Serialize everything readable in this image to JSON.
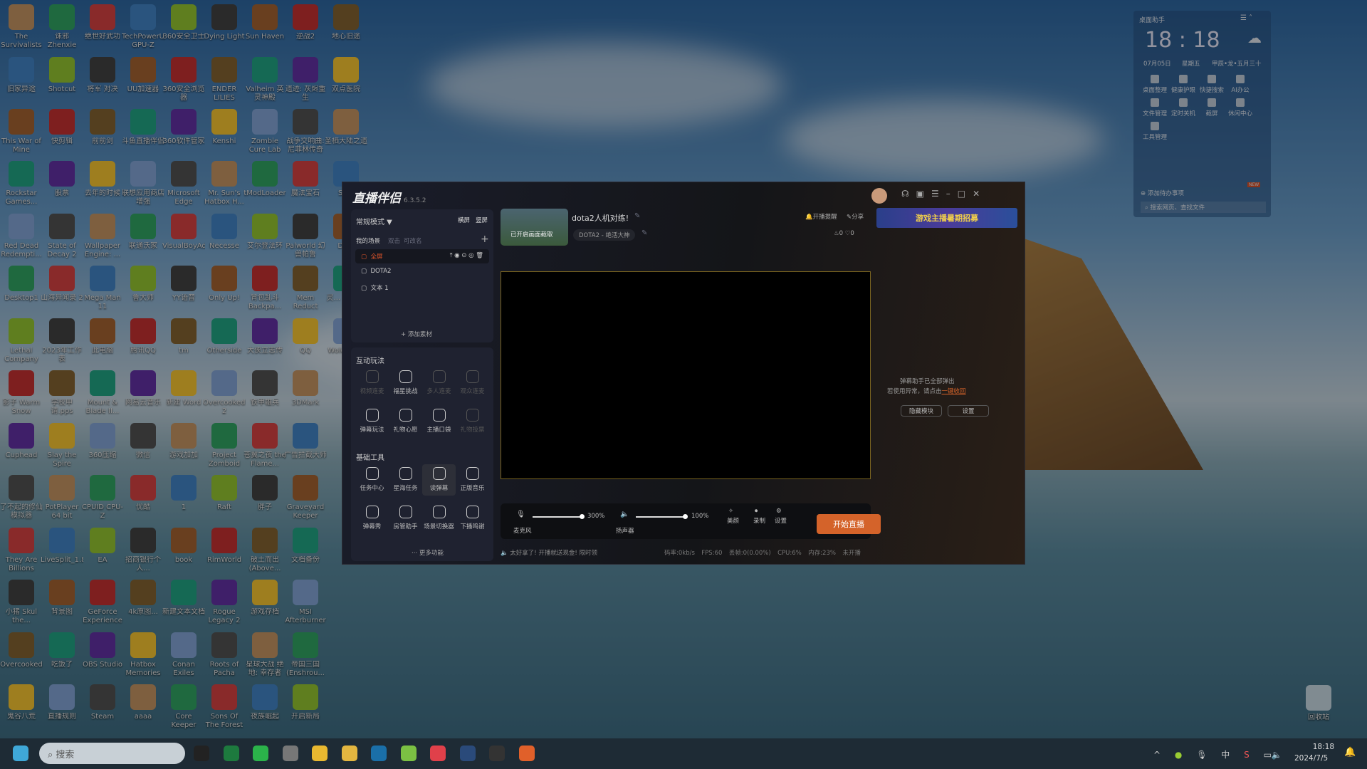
{
  "desktop": {
    "rows": [
      [
        "The Survivalists",
        "诛邪 Zhenxie",
        "绝世好武功",
        "TechPowerUp GPU-Z",
        "360安全卫士",
        "Dying Light",
        "Sun Haven",
        "逆战2",
        "地心旧途"
      ],
      [
        "旧家异途",
        "Shotcut",
        "将军 对决",
        "UU加速器",
        "360安全浏览器",
        "ENDER LILIES",
        "Valheim 英灵神殿",
        "遗迹: 灰烬重生",
        "双点医院"
      ],
      [
        "This War of Mine",
        "快剪辑",
        "前前剑",
        "斗鱼直播伴侣",
        "360软件管家",
        "Kenshi",
        "Zombie Cure Lab",
        "战争交响曲: 尼菲林传奇",
        "圣栖大陆之遗"
      ],
      [
        "Rockstar Games...",
        "股票",
        "去年的时候",
        "联想应用商店增强",
        "Microsoft Edge",
        "Mr. Sun's Hatbox H...",
        "tModLoader",
        "魔法宝石",
        "Sa..."
      ],
      [
        "Red Dead Redempti...",
        "State of Decay 2",
        "Wallpaper Engine: ...",
        "联通沃家",
        "VisualBoyAdvance[1.8...",
        "Necesse",
        "艾尔登法环",
        "Palworld 幻兽帕鲁",
        "Do..."
      ],
      [
        "Desktop1",
        "山海异闻录 2",
        "Mega Man 11",
        "鲁大师",
        "YY语音",
        "Only Up!",
        "背包乱斗 Backpa...",
        "Mem Reduct",
        "灵... (Sou..."
      ],
      [
        "Lethal Company",
        "2023年工作表",
        "此电脑",
        "腾讯QQ",
        "tm",
        "Otherside",
        "大侠立志传",
        "QQ",
        "Wolo Far..."
      ],
      [
        "影子 Warm Snow",
        "学校申请.pps",
        "Mount & Blade II...",
        "网易云音乐",
        "新建 Word",
        "Overcooked! 2",
        "铁甲雄兵",
        "3DMark"
      ],
      [
        "Cuphead",
        "Slay the Spire",
        "360压缩",
        "微信",
        "游戏加加",
        "Project Zomboid",
        "苍翼之夜 the Flame...",
        "广告拦截大师"
      ],
      [
        "了不起的修仙模拟器",
        "PotPlayer 64 bit",
        "CPUID CPU-Z",
        "优酷",
        "1",
        "Raft",
        "胖子",
        "Graveyard Keeper"
      ],
      [
        "They Are Billions",
        "LiveSplit_1.8.29",
        "EA",
        "招商银行个人...",
        "book",
        "RimWorld",
        "破土而出 (Above...",
        "文档备份"
      ],
      [
        "小猪 Skul the...",
        "背景图",
        "GeForce Experience",
        "4k原图...",
        "新建文本文档",
        "Rogue Legacy 2",
        "游戏存档",
        "MSI Afterburner"
      ],
      [
        "Overcooked",
        "吃饭了",
        "OBS Studio",
        "Hatbox Memories",
        "Conan Exiles",
        "Roots of Pacha",
        "星球大战 绝地: 幸存者",
        "帝国三国 (Enshrou..."
      ],
      [
        "鬼谷八荒",
        "直播规则",
        "Steam",
        "aaaa",
        "Core Keeper",
        "Sons Of The Forest",
        "夜族崛起",
        "开启新局"
      ]
    ],
    "recycle_bin": "回收站"
  },
  "app": {
    "name": "直播伴侣",
    "version": "6.3.5.2",
    "mode": "常规模式",
    "orient_h": "横屏",
    "orient_v": "竖屏",
    "scenes_label": "我的场景",
    "scenes_hint1": "双击",
    "scenes_hint2": "可改名",
    "scenes": [
      {
        "label": "全屏",
        "active": true
      },
      {
        "label": "DOTA2"
      },
      {
        "label": "文本 1"
      }
    ],
    "add_material": "添加素材",
    "interactive_title": "互动玩法",
    "interactive": [
      {
        "label": "视频连麦",
        "off": true
      },
      {
        "label": "福星挑战"
      },
      {
        "label": "多人连麦",
        "off": true
      },
      {
        "label": "观众连麦",
        "off": true
      },
      {
        "label": "弹幕玩法"
      },
      {
        "label": "礼物心愿"
      },
      {
        "label": "主播口袋"
      },
      {
        "label": "礼物投票",
        "off": true
      }
    ],
    "tools_title": "基础工具",
    "tools": [
      {
        "label": "任务中心"
      },
      {
        "label": "星海任务"
      },
      {
        "label": "读弹幕",
        "selected": true
      },
      {
        "label": "正版音乐"
      },
      {
        "label": "弹幕秀"
      },
      {
        "label": "房管助手"
      },
      {
        "label": "场景切换器"
      },
      {
        "label": "下播鸣谢"
      }
    ],
    "more": "更多功能",
    "stream_title": "dota2人机对练!",
    "thumb_caption": "已开启画面截取",
    "category": "DOTA2 - 绝活大神",
    "remind": "开播提醒",
    "share": "分享",
    "fire_count": "0",
    "like_count": "0",
    "banner": "游戏主播暑期招募",
    "mic_label": "麦克风",
    "mic_volume": "300%",
    "speaker_label": "扬声器",
    "speaker_volume": "100%",
    "beauty": "美颜",
    "record": "录制",
    "settings": "设置",
    "start": "开始直播",
    "notice": "太好拿了! 开播就送现金! 限时领",
    "stats": {
      "bitrate": "码率:0kb/s",
      "fps": "FPS:60",
      "dropped": "丢帧:0(0.00%)",
      "cpu": "CPU:6%",
      "mem": "内存:23%",
      "state": "未开播"
    },
    "danmu_line1": "弹幕助手已全部弹出",
    "danmu_line2": "若使用异常，请点击",
    "danmu_link": "一键收回",
    "hide_module": "隐藏模块",
    "danmu_settings": "设置",
    "accent": "#d4632a"
  },
  "widget": {
    "title": "桌面助手",
    "time": "18 : 18",
    "date": "07月05日",
    "weekday": "星期五",
    "lunar": "甲辰•龙•五月三十",
    "tools": [
      "桌面整理",
      "健康护眼",
      "快捷搜索",
      "AI办公",
      "文件管理",
      "定时关机",
      "截屏",
      "休闲中心",
      "工具管理"
    ],
    "new_badge": "NEW",
    "todo": "添加待办事项",
    "search_placeholder": "搜索网页、查找文件"
  },
  "taskbar": {
    "search_placeholder": "搜索",
    "time": "18:18",
    "date": "2024/7/5",
    "ime": "中",
    "apps": [
      "qq",
      "excel",
      "wechat",
      "app",
      "file-explorer",
      "yy",
      "uu",
      "360-browser",
      "netease-music",
      "steam",
      "obs",
      "douyu-companion"
    ]
  }
}
